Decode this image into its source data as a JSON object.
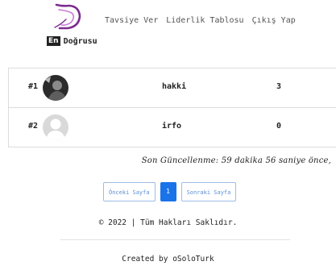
{
  "header": {
    "brand_badge": "En",
    "brand_text": "Doğrusu",
    "nav": [
      "Tavsiye Ver",
      "Liderlik Tablosu",
      "Çıkış Yap"
    ],
    "colors": {
      "logo": "#7b2d8e"
    }
  },
  "leaderboard": {
    "rows": [
      {
        "rank": "#1",
        "name": "hakki",
        "score": "3",
        "avatar": "photo-avatar"
      },
      {
        "rank": "#2",
        "name": "irfo",
        "score": "0",
        "avatar": "default-user-icon"
      }
    ]
  },
  "last_update": "Son Güncellenme: 59 dakika 56 saniye önce,",
  "pagination": {
    "prev": "Önceki Sayfa",
    "current": "1",
    "next": "Sonraki Sayfa",
    "colors": {
      "active": "#1a73e8",
      "outline": "#5b8fd6"
    }
  },
  "footer": {
    "copyright": "© 2022 | Tüm Hakları Saklıdır.",
    "credit": "Created by oSoloTurk"
  }
}
